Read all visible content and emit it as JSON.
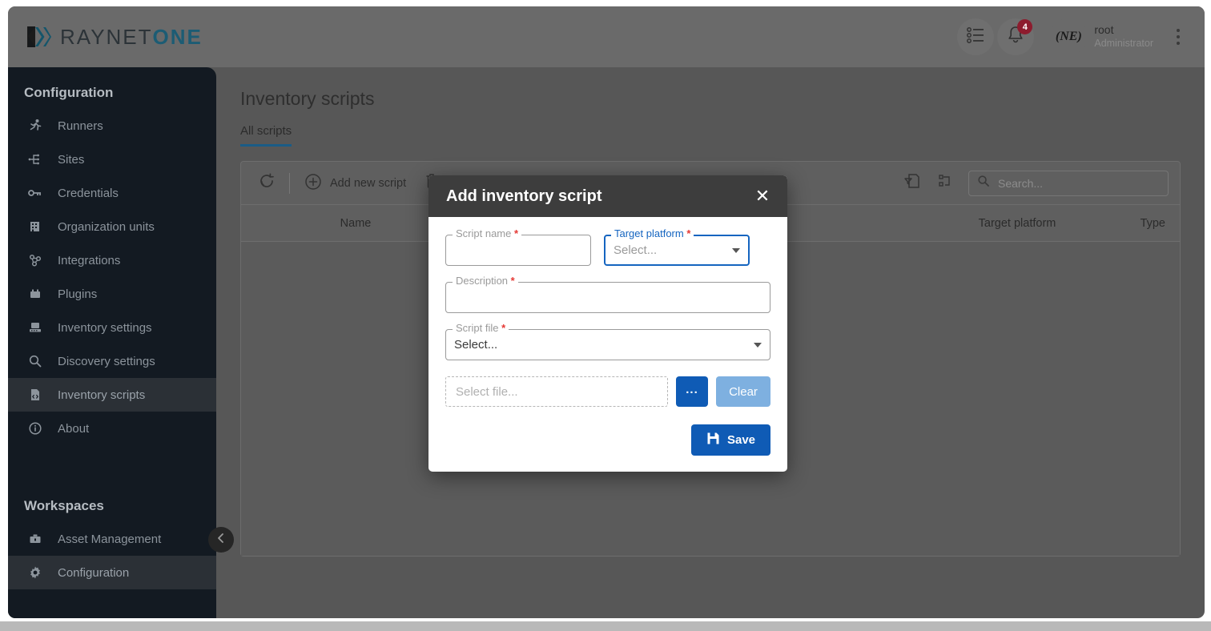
{
  "brand": {
    "logo_word_1": "RAYNET",
    "logo_word_2": "ONE",
    "accent_teal": "#1c5c74",
    "accent_blue": "#0f5bb5",
    "badge_red": "#8d1c2e"
  },
  "topbar": {
    "list_icon": "list-icon",
    "bell_icon": "bell-icon",
    "notification_count": "4",
    "avatar_text": "(NE)",
    "user_name": "root",
    "user_role": "Administrator",
    "kebab_icon": "more-vertical-icon"
  },
  "sidebar": {
    "section_configuration": "Configuration",
    "section_workspaces": "Workspaces",
    "configuration_items": [
      {
        "label": "Runners",
        "icon": "runner-icon",
        "active": false
      },
      {
        "label": "Sites",
        "icon": "sitemap-icon",
        "active": false
      },
      {
        "label": "Credentials",
        "icon": "key-icon",
        "active": false
      },
      {
        "label": "Organization units",
        "icon": "building-icon",
        "active": false
      },
      {
        "label": "Integrations",
        "icon": "integrations-icon",
        "active": false
      },
      {
        "label": "Plugins",
        "icon": "plugin-icon",
        "active": false
      },
      {
        "label": "Inventory settings",
        "icon": "inventory-icon",
        "active": false
      },
      {
        "label": "Discovery settings",
        "icon": "search-icon",
        "active": false
      },
      {
        "label": "Inventory scripts",
        "icon": "script-file-icon",
        "active": true
      },
      {
        "label": "About",
        "icon": "info-icon",
        "active": false
      }
    ],
    "workspace_items": [
      {
        "label": "Asset Management",
        "icon": "briefcase-icon",
        "active": false
      },
      {
        "label": "Configuration",
        "icon": "gear-icon",
        "active": true
      }
    ],
    "collapse_icon": "chevron-left-icon"
  },
  "main": {
    "page_title": "Inventory scripts",
    "tabs": [
      {
        "label": "All scripts",
        "active": true
      }
    ],
    "toolbar": {
      "refresh_icon": "refresh-icon",
      "add_icon": "plus-circle-icon",
      "add_label": "Add new script",
      "delete_icon": "trash-icon",
      "filter_icon": "filter-export-icon",
      "columns_icon": "columns-icon",
      "search_icon": "search-icon",
      "search_placeholder": "Search...",
      "search_value": ""
    },
    "table": {
      "columns": [
        "Name",
        "Target platform",
        "Type"
      ],
      "rows": []
    }
  },
  "modal": {
    "title": "Add inventory script",
    "close_icon": "close-icon",
    "fields": {
      "script_name": {
        "label": "Script name",
        "required_marker": "*",
        "value": "",
        "focused": false
      },
      "target_platform": {
        "label": "Target platform",
        "required_marker": "*",
        "value": "Select...",
        "focused": true,
        "caret_icon": "chevron-down-icon"
      },
      "description": {
        "label": "Description",
        "required_marker": "*",
        "value": "",
        "focused": false
      },
      "script_file": {
        "label": "Script file",
        "required_marker": "*",
        "value": "Select...",
        "focused": false,
        "caret_icon": "chevron-down-icon"
      },
      "file_picker": {
        "placeholder": "Select file...",
        "value": "",
        "browse_label": "...",
        "clear_label": "Clear"
      }
    },
    "save_label": "Save",
    "save_icon": "save-disk-icon"
  }
}
